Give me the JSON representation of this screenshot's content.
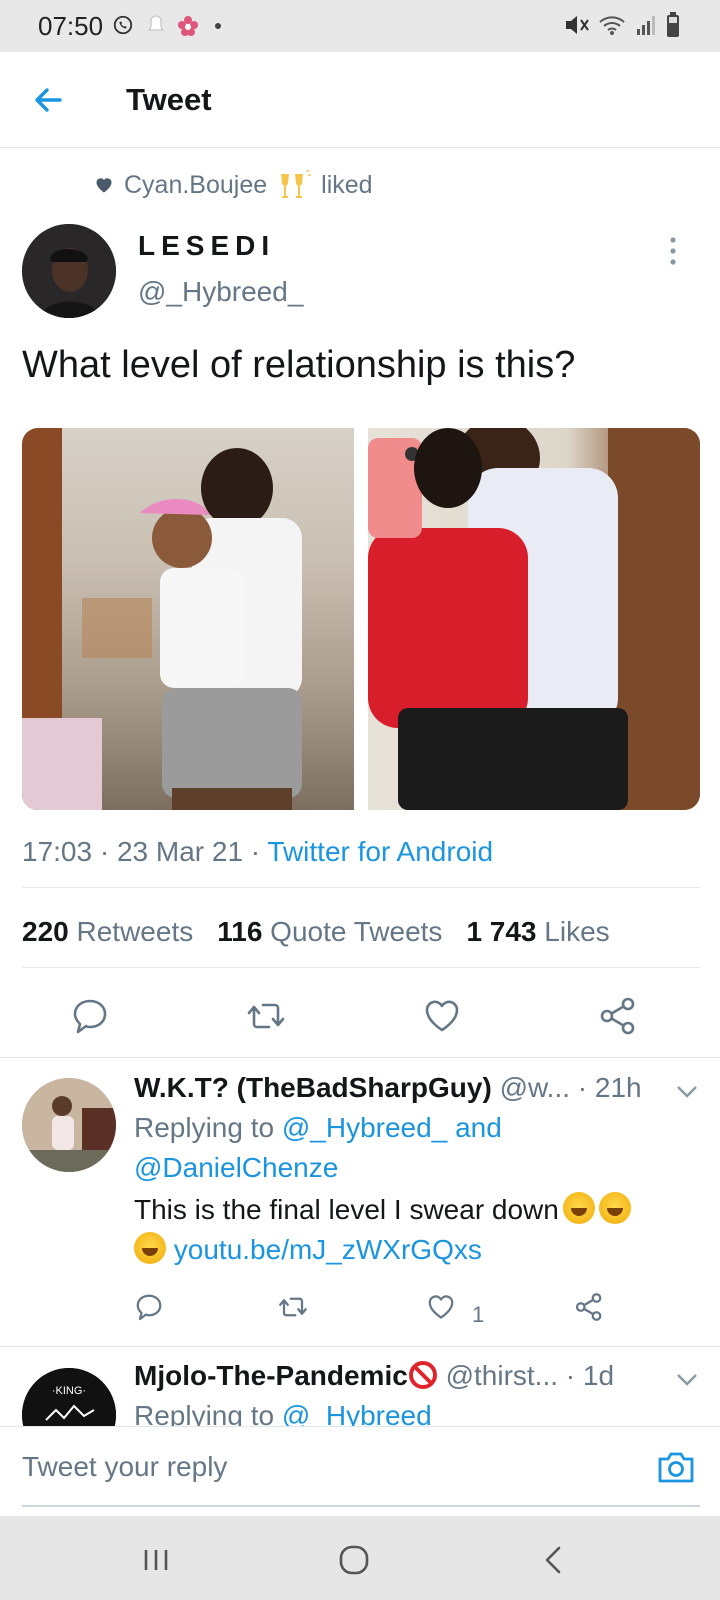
{
  "status_bar": {
    "time": "07:50"
  },
  "header": {
    "title": "Tweet"
  },
  "context": {
    "liked_by": "Cyan.Boujee",
    "liked_suffix": "liked"
  },
  "tweet": {
    "author_name": "LESEDI",
    "author_handle": "@_Hybreed_",
    "text": "What level of relationship is this?",
    "time": "17:03 · 23 Mar 21 ·",
    "source": "Twitter for Android",
    "stats": {
      "retweets_count": "220",
      "retweets_label": "Retweets",
      "quotes_count": "116",
      "quotes_label": "Quote Tweets",
      "likes_count": "1 743",
      "likes_label": "Likes"
    }
  },
  "replies": [
    {
      "name": "W.K.T? (TheBadSharpGuy)",
      "handle": "@w...",
      "age": "· 21h",
      "replying_prefix": "Replying to",
      "replying_to_1": "@_Hybreed_",
      "replying_and": "and",
      "replying_to_2": "@DanielChenze",
      "text": "This is the final level I swear down",
      "link": "youtu.be/mJ_zWXrGQxs",
      "like_count": "1"
    },
    {
      "name": "Mjolo-The-Pandemic",
      "handle": "@thirst...",
      "age": "· 1d",
      "replying_prefix": "Replying to",
      "replying_to_1": "@_Hybreed"
    }
  ],
  "reply_box": {
    "placeholder": "Tweet your reply"
  },
  "colors": {
    "accent": "#1b95e0",
    "secondary_text": "#657786",
    "divider": "#e1e8ed"
  }
}
